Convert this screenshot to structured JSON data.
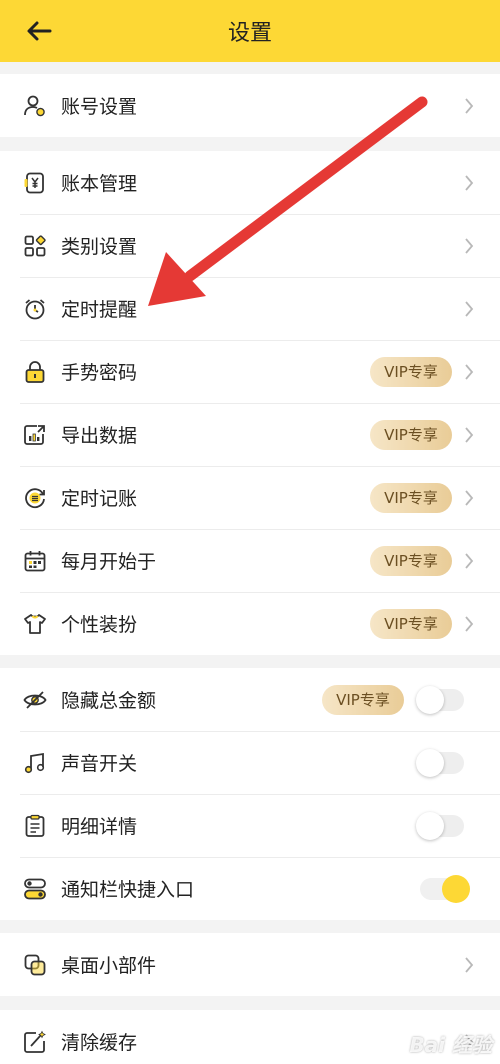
{
  "header": {
    "title": "设置",
    "back_icon": "arrow-left-icon",
    "background": "#fdd835"
  },
  "groups": [
    {
      "items": [
        {
          "label": "账号设置",
          "icon": "user-gear-icon",
          "accessory": "chevron"
        }
      ]
    },
    {
      "items": [
        {
          "label": "账本管理",
          "icon": "ledger-yen-icon",
          "accessory": "chevron"
        },
        {
          "label": "类别设置",
          "icon": "category-grid-icon",
          "accessory": "chevron"
        },
        {
          "label": "定时提醒",
          "icon": "alarm-clock-icon",
          "accessory": "chevron"
        },
        {
          "label": "手势密码",
          "icon": "lock-icon",
          "accessory": "vip-chevron",
          "badge": "VIP专享"
        },
        {
          "label": "导出数据",
          "icon": "export-data-icon",
          "accessory": "vip-chevron",
          "badge": "VIP专享"
        },
        {
          "label": "定时记账",
          "icon": "scheduled-record-icon",
          "accessory": "vip-chevron",
          "badge": "VIP专享"
        },
        {
          "label": "每月开始于",
          "icon": "calendar-icon",
          "accessory": "vip-chevron",
          "badge": "VIP专享"
        },
        {
          "label": "个性装扮",
          "icon": "tshirt-icon",
          "accessory": "vip-chevron",
          "badge": "VIP专享"
        }
      ]
    },
    {
      "items": [
        {
          "label": "隐藏总金额",
          "icon": "eye-hidden-icon",
          "accessory": "vip-toggle",
          "badge": "VIP专享",
          "toggle": false
        },
        {
          "label": "声音开关",
          "icon": "music-note-icon",
          "accessory": "toggle",
          "toggle": false
        },
        {
          "label": "明细详情",
          "icon": "list-detail-icon",
          "accessory": "toggle",
          "toggle": false
        },
        {
          "label": "通知栏快捷入口",
          "icon": "switch-icon",
          "accessory": "toggle",
          "toggle": true
        }
      ]
    },
    {
      "items": [
        {
          "label": "桌面小部件",
          "icon": "widget-icon",
          "accessory": "chevron"
        }
      ]
    },
    {
      "items": [
        {
          "label": "清除缓存",
          "icon": "clear-cache-icon",
          "accessory": "chevron"
        }
      ]
    }
  ],
  "annotation": {
    "arrow_color": "#e53935"
  },
  "watermark": "Bai 经验"
}
